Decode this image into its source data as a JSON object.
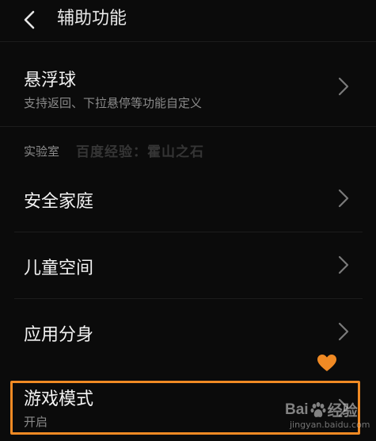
{
  "header": {
    "title": "辅助功能"
  },
  "rows": {
    "floating_ball": {
      "title": "悬浮球",
      "subtitle": "支持返回、下拉悬停等功能自定义"
    },
    "section_lab": {
      "label": "实验室"
    },
    "watermark": {
      "text": "百度经验：霍山之石",
      "logo_left": "Bai",
      "logo_right": "经验",
      "logo_url_text": "jingyan.baidu.com"
    },
    "safe_family": {
      "title": "安全家庭"
    },
    "kids_space": {
      "title": "儿童空间"
    },
    "app_clone": {
      "title": "应用分身"
    },
    "game_mode": {
      "title": "游戏模式",
      "subtitle": "开启"
    }
  },
  "colors": {
    "background": "#0b0b0b",
    "text_primary": "#f2f2f2",
    "text_secondary": "#8a8a8a",
    "highlight": "#f08a24"
  },
  "icons": {
    "back": "chevron-left-icon",
    "row_arrow": "chevron-right-icon",
    "heart": "heart-icon",
    "baidu_paw": "baidu-paw-icon"
  }
}
